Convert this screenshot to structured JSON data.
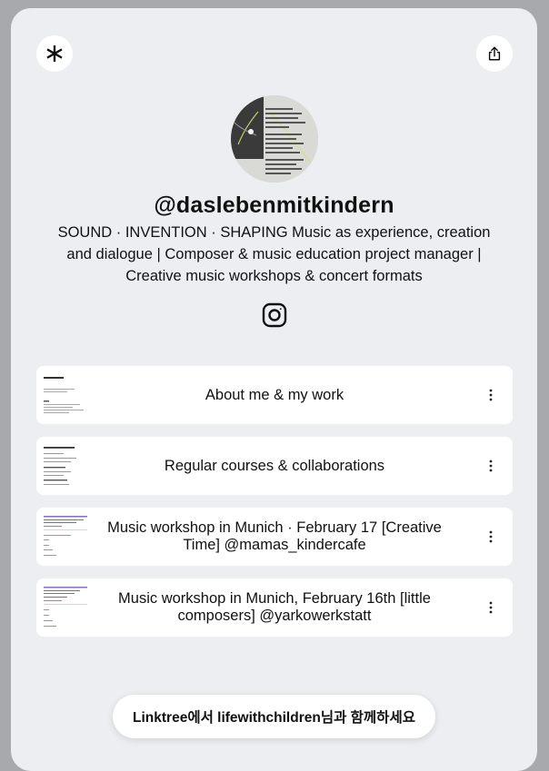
{
  "profile": {
    "handle": "@daslebenmitkindern",
    "bio": "SOUND · INVENTION · SHAPING Music as experience, creation and dialogue | Composer & music education project manager | Creative music workshops & concert formats"
  },
  "icons": {
    "top_left": "asterisk-logo-icon",
    "top_right": "share-icon",
    "social": "instagram-icon",
    "link_menu": "kebab-menu-icon"
  },
  "links": [
    {
      "label": "About me & my work"
    },
    {
      "label": "Regular courses & collaborations"
    },
    {
      "label": "Music workshop in Munich · February 17 [Creative Time] @mamas_kindercafe"
    },
    {
      "label": "Music workshop in Munich, February 16th [little composers] @yarkowerkstatt"
    }
  ],
  "footer": {
    "cta": "Linktree에서 lifewithchildren님과 함께하세요"
  },
  "colors": {
    "page_bg": "#a8a9ac",
    "card_bg": "#eceef1",
    "button_bg": "#ffffff",
    "text": "#111111"
  }
}
